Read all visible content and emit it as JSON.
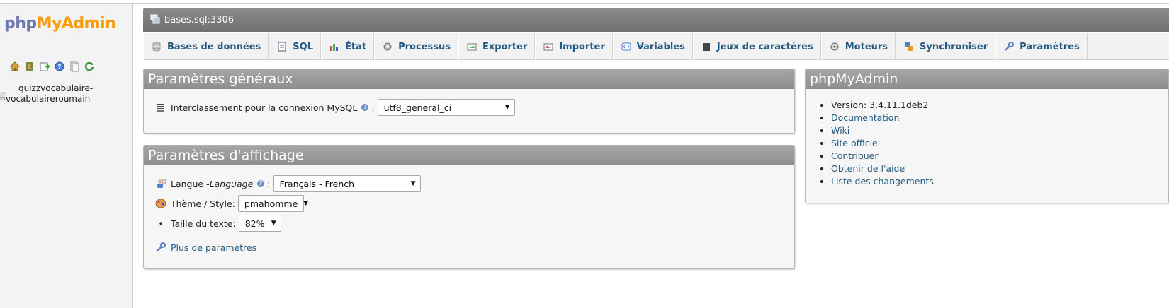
{
  "left": {
    "logo_php": "php",
    "logo_ma": "MyAdmin",
    "icons": [
      "home-icon",
      "exit-icon",
      "query-icon",
      "help-icon",
      "docs-icon",
      "reload-icon"
    ],
    "db_line1": "quizzvocabulaire-",
    "db_line2": "vocabulaireroumain"
  },
  "server": {
    "title": "bases.sql:3306"
  },
  "tabs": [
    {
      "label": "Bases de données",
      "icon": "database-icon"
    },
    {
      "label": "SQL",
      "icon": "sql-icon"
    },
    {
      "label": "État",
      "icon": "status-icon"
    },
    {
      "label": "Processus",
      "icon": "process-icon"
    },
    {
      "label": "Exporter",
      "icon": "export-icon"
    },
    {
      "label": "Importer",
      "icon": "import-icon"
    },
    {
      "label": "Variables",
      "icon": "variables-icon"
    },
    {
      "label": "Jeux de caractères",
      "icon": "charset-icon"
    },
    {
      "label": "Moteurs",
      "icon": "engines-icon"
    },
    {
      "label": "Synchroniser",
      "icon": "sync-icon"
    },
    {
      "label": "Paramètres",
      "icon": "wrench-icon"
    }
  ],
  "general": {
    "title": "Paramètres généraux",
    "collation_label": "Interclassement pour la connexion MySQL",
    "collation_value": "utf8_general_ci"
  },
  "display": {
    "title": "Paramètres d'affichage",
    "lang_label": "Langue - ",
    "lang_label_italic": "Language",
    "lang_value": "Français - French",
    "theme_label": "Thème / Style:",
    "theme_value": "pmahomme",
    "textsize_label": "Taille du texte:",
    "textsize_value": "82%",
    "more_link": "Plus de paramètres"
  },
  "pma": {
    "title": "phpMyAdmin",
    "version": "Version: 3.4.11.1deb2",
    "links": [
      "Documentation",
      "Wiki",
      "Site officiel",
      "Contribuer",
      "Obtenir de l'aide",
      "Liste des changements"
    ]
  },
  "colors": {
    "link": "#235a81",
    "logo_php": "#6c78af",
    "logo_myadmin": "#f89c0e",
    "header_grey": "#8f8f8f"
  }
}
